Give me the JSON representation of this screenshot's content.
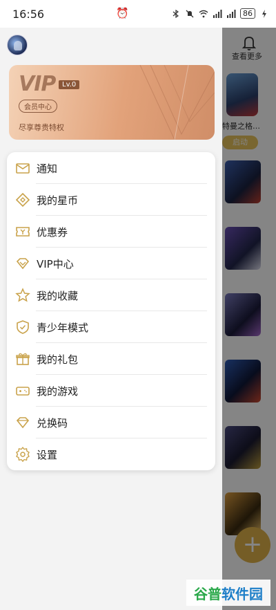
{
  "status_bar": {
    "time": "16:56",
    "battery": "86"
  },
  "background_app": {
    "view_more": "查看更多",
    "game_name": "特曼之格…",
    "start_button": "启动",
    "add_button": "+"
  },
  "drawer": {
    "vip_card": {
      "logo": "VIP",
      "level": "Lv.0",
      "member_center": "会员中心",
      "description": "尽享尊贵特权"
    },
    "menu": [
      {
        "label": "通知",
        "icon": "mail-icon"
      },
      {
        "label": "我的星币",
        "icon": "coin-icon"
      },
      {
        "label": "优惠券",
        "icon": "coupon-icon"
      },
      {
        "label": "VIP中心",
        "icon": "diamond-icon"
      },
      {
        "label": "我的收藏",
        "icon": "star-icon"
      },
      {
        "label": "青少年模式",
        "icon": "shield-icon"
      },
      {
        "label": "我的礼包",
        "icon": "gift-icon"
      },
      {
        "label": "我的游戏",
        "icon": "gamepad-icon"
      },
      {
        "label": "兑换码",
        "icon": "redeem-diamond-icon"
      },
      {
        "label": "设置",
        "icon": "gear-icon"
      }
    ]
  },
  "watermark": {
    "part1": "谷普",
    "part2": "软件园"
  },
  "colors": {
    "icon_gold": "#c9a24a",
    "vip_gradient_start": "#f4d2b6",
    "vip_gradient_end": "#d08e68"
  }
}
